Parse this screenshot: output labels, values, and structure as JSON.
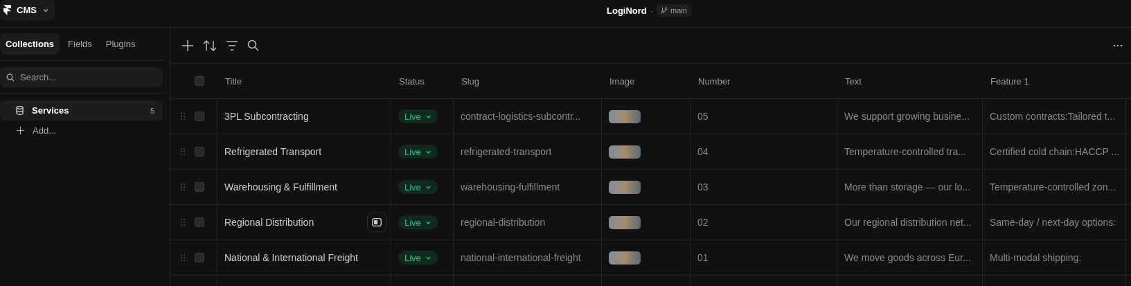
{
  "top_bar": {
    "app_menu": "CMS",
    "project": "LogiNord",
    "separator": "·",
    "branch": "main"
  },
  "sidebar": {
    "tabs": [
      {
        "label": "Collections",
        "selected": true
      },
      {
        "label": "Fields",
        "selected": false
      },
      {
        "label": "Plugins",
        "selected": false
      }
    ],
    "search": {
      "placeholder": "Search..."
    },
    "collections": [
      {
        "label": "Services",
        "count": "5",
        "selected": true
      }
    ],
    "add_label": "Add..."
  },
  "table": {
    "columns": [
      "Title",
      "Status",
      "Slug",
      "Image",
      "Number",
      "Text",
      "Feature 1"
    ],
    "header_checked": false,
    "rows": [
      {
        "checked": false,
        "title": "3PL Subcontracting",
        "open_button": false,
        "status": "Live",
        "slug": "contract-logistics-subcontr...",
        "number": "05",
        "text": "We support growing busine...",
        "feature_1": "Custom contracts:Tailored t..."
      },
      {
        "checked": false,
        "title": "Refrigerated Transport",
        "open_button": false,
        "status": "Live",
        "slug": "refrigerated-transport",
        "number": "04",
        "text": "Temperature-controlled tra...",
        "feature_1": "Certified cold chain:HACCP ..."
      },
      {
        "checked": false,
        "title": "Warehousing & Fulfillment",
        "open_button": false,
        "status": "Live",
        "slug": "warehousing-fulfillment",
        "number": "03",
        "text": "More than storage — our lo...",
        "feature_1": "Temperature-controlled zon..."
      },
      {
        "checked": false,
        "title": "Regional Distribution",
        "open_button": true,
        "status": "Live",
        "slug": "regional-distribution",
        "number": "02",
        "text": "Our regional distribution net...",
        "feature_1": "Same-day / next-day options:"
      },
      {
        "checked": false,
        "title": "National & International Freight",
        "open_button": false,
        "status": "Live",
        "slug": "national-international-freight",
        "number": "01",
        "text": "We move goods across Eur...",
        "feature_1": "Multi-modal shipping:"
      }
    ]
  }
}
